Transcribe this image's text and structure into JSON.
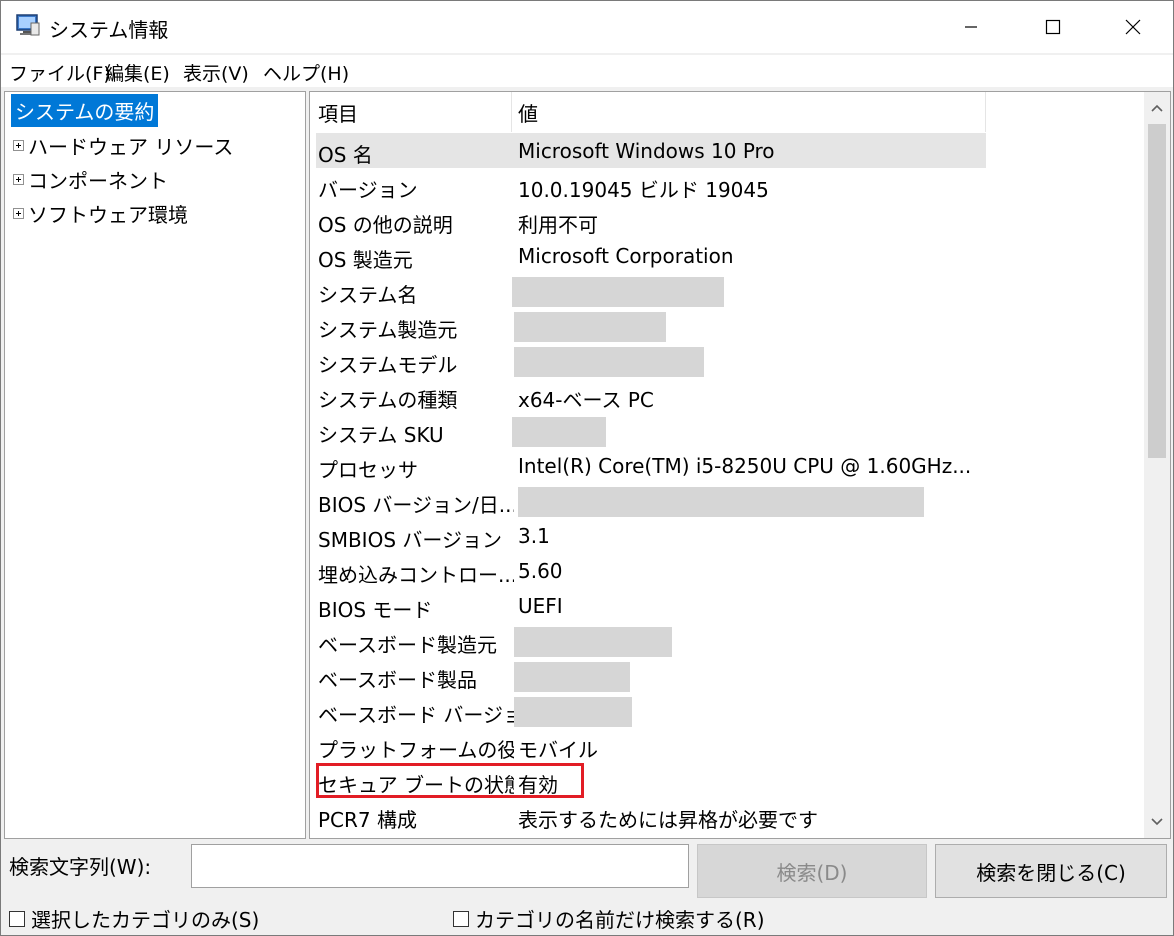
{
  "window": {
    "title": "システム情報"
  },
  "menu": [
    "ファイル(F)",
    "編集(E)",
    "表示(V)",
    "ヘルプ(H)"
  ],
  "tree": {
    "selected": "システムの要約",
    "children": [
      "ハードウェア リソース",
      "コンポーネント",
      "ソフトウェア環境"
    ]
  },
  "list": {
    "columns": [
      "項目",
      "値"
    ],
    "rows": [
      {
        "key": "OS 名",
        "value": "Microsoft Windows 10 Pro"
      },
      {
        "key": "バージョン",
        "value": "10.0.19045 ビルド 19045"
      },
      {
        "key": "OS の他の説明",
        "value": "利用不可"
      },
      {
        "key": "OS 製造元",
        "value": "Microsoft Corporation"
      },
      {
        "key": "システム名",
        "value": ""
      },
      {
        "key": "システム製造元",
        "value": ""
      },
      {
        "key": "システムモデル",
        "value": ""
      },
      {
        "key": "システムの種類",
        "value": "x64-ベース PC"
      },
      {
        "key": "システム SKU",
        "value": ""
      },
      {
        "key": "プロセッサ",
        "value": "Intel(R) Core(TM) i5-8250U CPU @ 1.60GHz..."
      },
      {
        "key": "BIOS バージョン/日...",
        "value": ""
      },
      {
        "key": "SMBIOS バージョン",
        "value": "3.1"
      },
      {
        "key": "埋め込みコントロー...",
        "value": "5.60"
      },
      {
        "key": "BIOS モード",
        "value": "UEFI"
      },
      {
        "key": "ベースボード製造元",
        "value": ""
      },
      {
        "key": "ベースボード製品",
        "value": ""
      },
      {
        "key": "ベースボード バージョン",
        "value": ""
      },
      {
        "key": "プラットフォームの役...",
        "value": "モバイル"
      },
      {
        "key": "セキュア ブートの状態",
        "value": "有効"
      },
      {
        "key": "PCR7 構成",
        "value": "表示するためには昇格が必要です"
      }
    ]
  },
  "search": {
    "label": "検索文字列(W):",
    "value": "",
    "search_button": "検索(D)",
    "close_button": "検索を閉じる(C)",
    "option_selected_only": "選択したカテゴリのみ(S)",
    "option_names_only": "カテゴリの名前だけ検索する(R)"
  },
  "colors": {
    "selection": "#0078d7",
    "highlight_box": "#e21d25"
  }
}
